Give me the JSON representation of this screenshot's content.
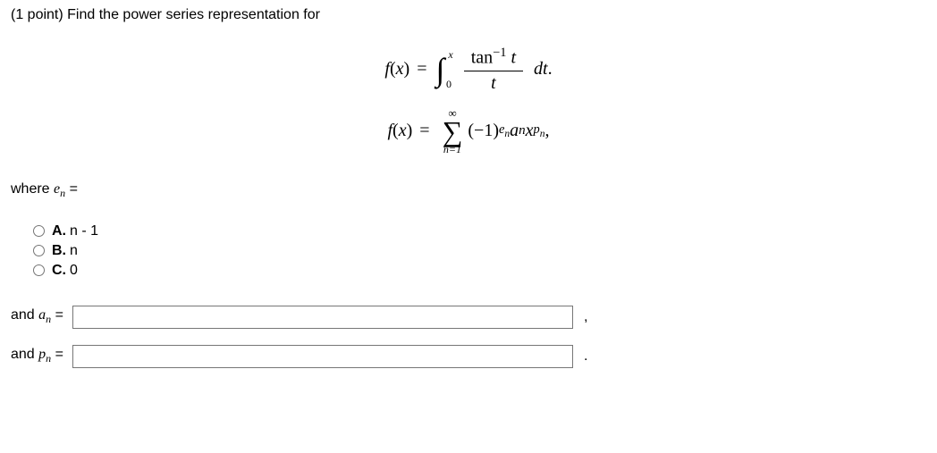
{
  "header": {
    "points": "(1 point)",
    "prompt": "Find the power series representation for"
  },
  "equations": {
    "fx": "f",
    "var": "x",
    "eq": "=",
    "integral_upper": "x",
    "integral_lower": "0",
    "tan": "tan",
    "tan_exp": "−1",
    "t": "t",
    "dt": "dt",
    "period1": ".",
    "sum_upper": "∞",
    "sum_lower": "n=1",
    "term_open": "(−1)",
    "exp_en_e": "e",
    "exp_en_n": "n",
    "a": "a",
    "sub_n": "n",
    "x2": "x",
    "exp_pn_p": "p",
    "exp_pn_n": "n",
    "trailing_comma": ","
  },
  "where": {
    "label_where": "where",
    "e": "e",
    "n": "n",
    "eq": "="
  },
  "choices": {
    "a_label": "A.",
    "a_text": "n - 1",
    "b_label": "B.",
    "b_text": "n",
    "c_label": "C.",
    "c_text": "0"
  },
  "inputs": {
    "and1": "and",
    "a": "a",
    "n1": "n",
    "eq1": "=",
    "val_an": "",
    "comma": ",",
    "and2": "and",
    "p": "p",
    "n2": "n",
    "eq2": "=",
    "val_pn": "",
    "period": "."
  }
}
